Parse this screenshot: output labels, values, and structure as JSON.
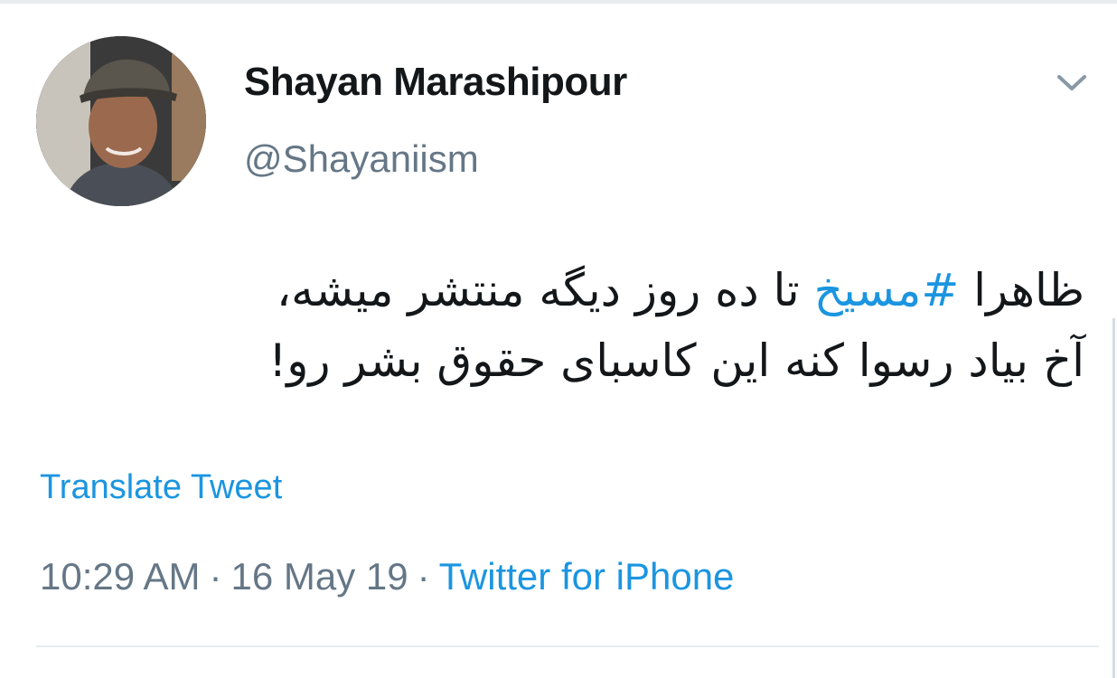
{
  "tweet": {
    "author": {
      "display_name": "Shayan Marashipour",
      "handle": "@Shayaniism",
      "avatar_icon": "user-avatar-photo"
    },
    "menu_icon": "chevron-down-icon",
    "text": {
      "line1_prefix": "ظاهرا ",
      "hashtag": "#مسیخ",
      "line1_suffix": " تا ده روز دیگه منتشر میشه،",
      "line2": "آخ بیاد رسوا کنه این کاسبای حقوق بشر رو!"
    },
    "translate_label": "Translate Tweet",
    "meta": {
      "time": "10:29 AM",
      "separator": "·",
      "date": "16 May 19",
      "source": "Twitter for iPhone"
    }
  },
  "colors": {
    "link": "#1b95e0",
    "text": "#14171a",
    "secondary": "#657786",
    "divider": "#e6ecf0"
  }
}
